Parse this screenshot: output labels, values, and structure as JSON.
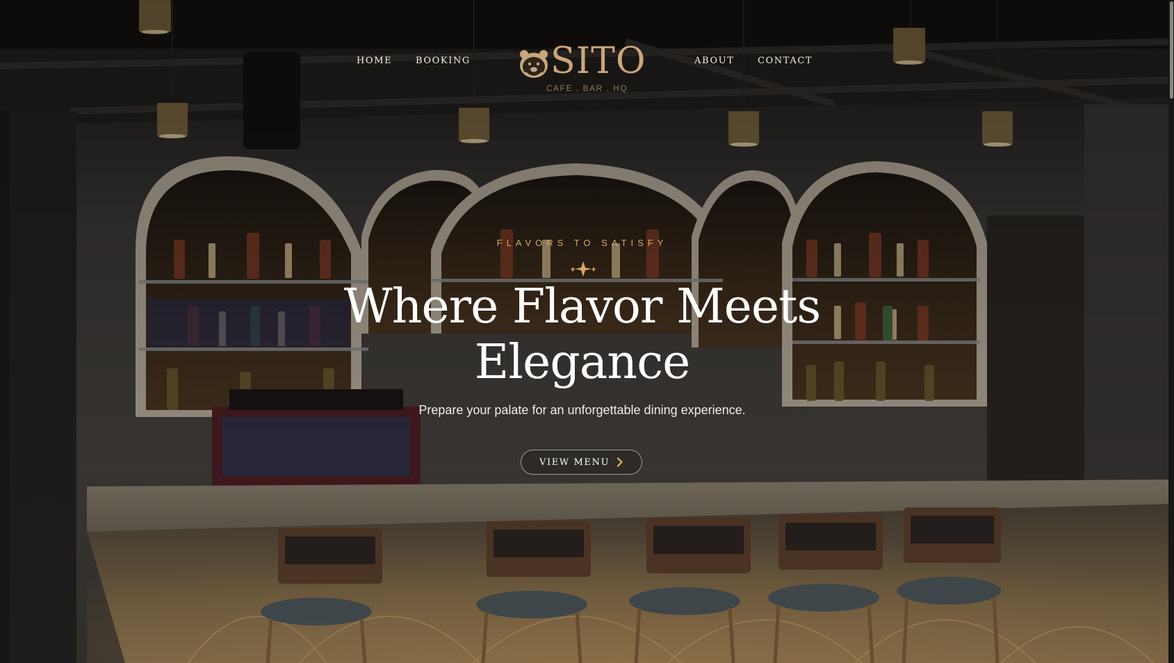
{
  "nav": {
    "left_items": [
      {
        "label": "HOME"
      },
      {
        "label": "BOOKING"
      }
    ],
    "right_items": [
      {
        "label": "ABOUT"
      },
      {
        "label": "CONTACT"
      }
    ]
  },
  "logo": {
    "wordmark": "SITO",
    "tagline": "CAFE . BAR . HQ",
    "icon": "bear-icon"
  },
  "hero": {
    "eyebrow": "FLAVORS TO SATISFY",
    "title_line1": "Where Flavor Meets",
    "title_line2": "Elegance",
    "subtitle": "Prepare your palate for an unforgettable dining experience.",
    "cta_label": "VIEW MENU",
    "cta_icon": "chevron-right-icon",
    "divider_icon": "sparkle-icon"
  },
  "colors": {
    "accent": "#caa67c",
    "eyebrow": "#d7a866",
    "text": "#ffffff"
  }
}
